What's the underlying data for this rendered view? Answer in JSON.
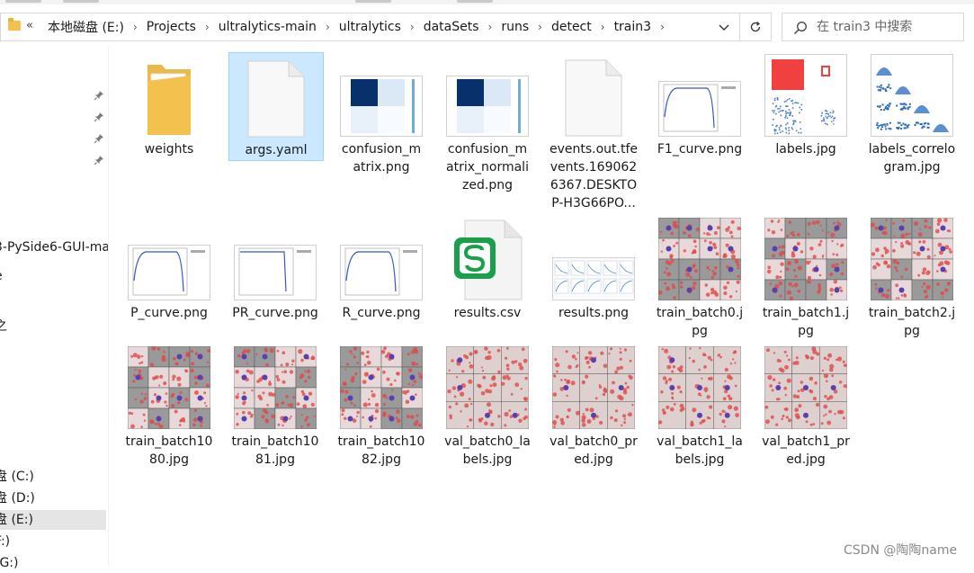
{
  "address_bar": {
    "overflow": "«",
    "crumbs": [
      "本地磁盘 (E:)",
      "Projects",
      "ultralytics-main",
      "ultralytics",
      "dataSets",
      "runs",
      "detect",
      "train3"
    ]
  },
  "search": {
    "placeholder": "在 train3 中搜索"
  },
  "nav": {
    "pinned_count": 4,
    "items": [
      {
        "label": "3-PySide6-GUI-ma"
      },
      {
        "label": "e"
      },
      {
        "label": "之"
      },
      {
        "label": "盘 (C:)"
      },
      {
        "label": "盘 (D:)"
      },
      {
        "label": "盘 (E:)",
        "selected": true
      },
      {
        "label": "F:)"
      },
      {
        "label": "(G:)"
      }
    ]
  },
  "files": [
    {
      "name": "weights",
      "lines": [
        "weights"
      ],
      "type": "folder"
    },
    {
      "name": "args.yaml",
      "lines": [
        "args.yaml"
      ],
      "type": "document",
      "selected": true
    },
    {
      "name": "confusion_matrix.png",
      "lines": [
        "confusion_m",
        "atrix.png"
      ],
      "type": "matrix"
    },
    {
      "name": "confusion_matrix_normalized.png",
      "lines": [
        "confusion_m",
        "atrix_normali",
        "zed.png"
      ],
      "type": "matrix"
    },
    {
      "name": "events.out.tfevents.1690626367.DESKTOP-H3G66PO...",
      "lines": [
        "events.out.tfe",
        "vents.169062",
        "6367.DESKTO",
        "P-H3G66PO..."
      ],
      "type": "document"
    },
    {
      "name": "F1_curve.png",
      "lines": [
        "F1_curve.png"
      ],
      "type": "curve"
    },
    {
      "name": "labels.jpg",
      "lines": [
        "labels.jpg"
      ],
      "type": "labels"
    },
    {
      "name": "labels_correlogram.jpg",
      "lines": [
        "labels_correlo",
        "gram.jpg"
      ],
      "type": "correlogram"
    },
    {
      "name": "P_curve.png",
      "lines": [
        "P_curve.png"
      ],
      "type": "curve"
    },
    {
      "name": "PR_curve.png",
      "lines": [
        "PR_curve.png"
      ],
      "type": "prcurve"
    },
    {
      "name": "R_curve.png",
      "lines": [
        "R_curve.png"
      ],
      "type": "curve"
    },
    {
      "name": "results.csv",
      "lines": [
        "results.csv"
      ],
      "type": "csv"
    },
    {
      "name": "results.png",
      "lines": [
        "results.png"
      ],
      "type": "results"
    },
    {
      "name": "train_batch0.jpg",
      "lines": [
        "train_batch0.j",
        "pg"
      ],
      "type": "mosaic"
    },
    {
      "name": "train_batch1.jpg",
      "lines": [
        "train_batch1.j",
        "pg"
      ],
      "type": "mosaic"
    },
    {
      "name": "train_batch2.jpg",
      "lines": [
        "train_batch2.j",
        "pg"
      ],
      "type": "mosaic"
    },
    {
      "name": "train_batch1080.jpg",
      "lines": [
        "train_batch10",
        "80.jpg"
      ],
      "type": "mosaic"
    },
    {
      "name": "train_batch1081.jpg",
      "lines": [
        "train_batch10",
        "81.jpg"
      ],
      "type": "mosaic"
    },
    {
      "name": "train_batch1082.jpg",
      "lines": [
        "train_batch10",
        "82.jpg"
      ],
      "type": "mosaic"
    },
    {
      "name": "val_batch0_labels.jpg",
      "lines": [
        "val_batch0_la",
        "bels.jpg"
      ],
      "type": "valmosaic"
    },
    {
      "name": "val_batch0_pred.jpg",
      "lines": [
        "val_batch0_pr",
        "ed.jpg"
      ],
      "type": "valmosaic"
    },
    {
      "name": "val_batch1_labels.jpg",
      "lines": [
        "val_batch1_la",
        "bels.jpg"
      ],
      "type": "valmosaic"
    },
    {
      "name": "val_batch1_pred.jpg",
      "lines": [
        "val_batch1_pr",
        "ed.jpg"
      ],
      "type": "valmosaic"
    }
  ],
  "colors": {
    "selection_bg": "#cce8ff",
    "folder": "#f2c14e",
    "matrix_dark": "#08306b",
    "curve_line": "#3a55c4",
    "csv_green": "#1aa04a",
    "labels_red": "#f04040"
  },
  "watermark": "CSDN @陶陶name"
}
